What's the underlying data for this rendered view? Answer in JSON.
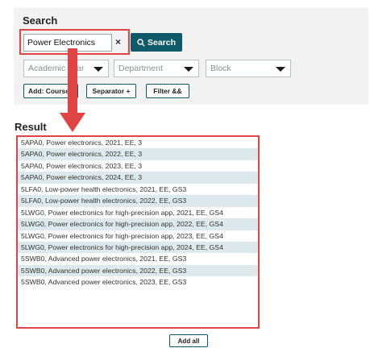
{
  "search": {
    "title": "Search",
    "input_value": "Power Electronics",
    "clear_label": "×",
    "button_label": "Search"
  },
  "filters": {
    "academic_year": "Academic year",
    "department": "Department",
    "block": "Block"
  },
  "actions": {
    "add_course": "Add: Course",
    "separator": "Separator +",
    "filter": "Filter &&"
  },
  "result": {
    "title": "Result",
    "items": [
      "5APA0, Power electronics, 2021, EE, 3",
      "5APA0, Power electronics, 2022, EE, 3",
      "5APA0, Power electronics, 2023, EE, 3",
      "5APA0, Power electronics, 2024, EE, 3",
      "5LFA0, Low-power health electronics, 2021, EE, GS3",
      "5LFA0, Low-power health electronics, 2022, EE, GS3",
      "5LWG0, Power electronics for high-precision app, 2021, EE, GS4",
      "5LWG0, Power electronics for high-precision app, 2022, EE, GS4",
      "5LWG0, Power electronics for high-precision app, 2023, EE, GS4",
      "5LWG0, Power electronics for high-precision app, 2024, EE, GS4",
      "5SWB0, Advanced power electronics, 2021, EE, GS3",
      "5SWB0, Advanced power electronics, 2022, EE, GS3",
      "5SWB0, Advanced power electronics, 2023, EE, GS3"
    ],
    "add_all_label": "Add all"
  },
  "colors": {
    "accent": "#0f5a68",
    "highlight": "#e04444",
    "row_alt": "#dde9ec",
    "panel_bg": "#f2f2f2"
  }
}
